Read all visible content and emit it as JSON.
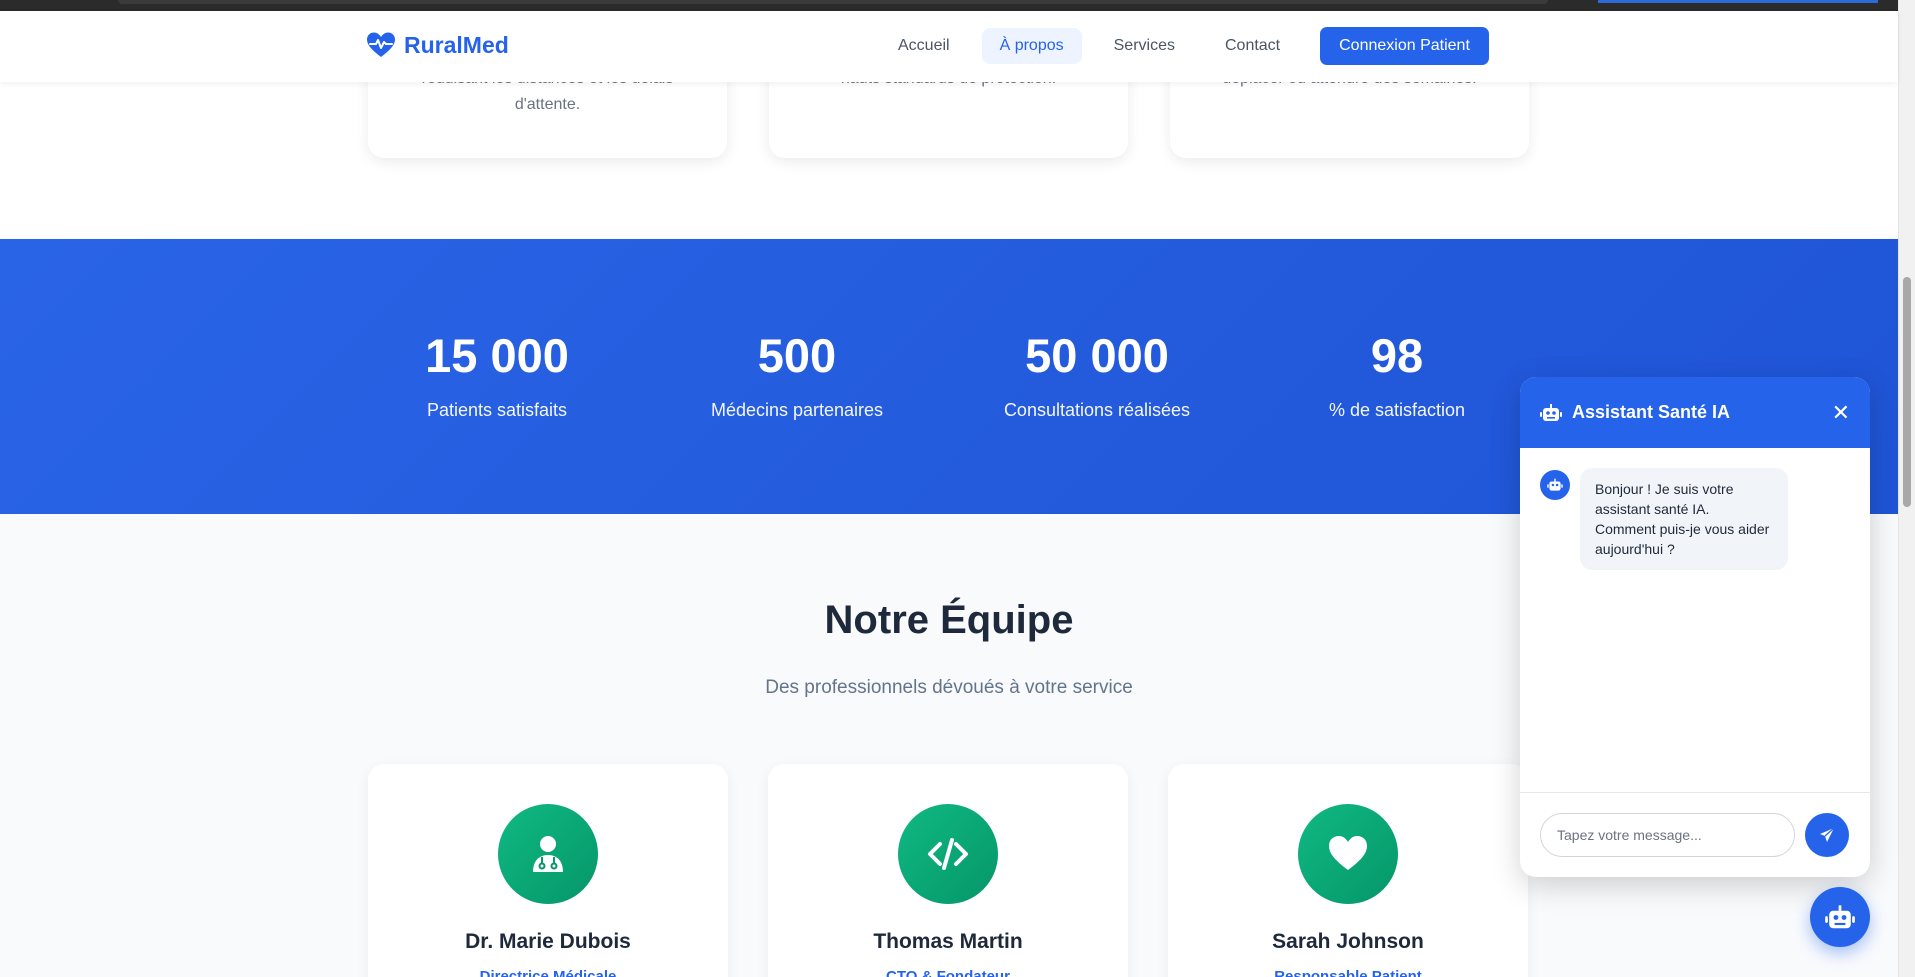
{
  "brand": {
    "name": "RuralMed",
    "color": "#2563eb"
  },
  "nav": {
    "items": [
      "Accueil",
      "À propos",
      "Services",
      "Contact"
    ],
    "active": "À propos",
    "login_label": "Connexion Patient"
  },
  "features": [
    {
      "text_line1": "réduisant les distances et les délais",
      "text_line2": "d'attente."
    },
    {
      "text_line1": "hauts standards de protection.",
      "text_line2": ""
    },
    {
      "text_line1": "déplacer ou attendre des semaines.",
      "text_line2": ""
    }
  ],
  "stats": [
    {
      "value": "15 000",
      "label": "Patients satisfaits"
    },
    {
      "value": "500",
      "label": "Médecins partenaires"
    },
    {
      "value": "50 000",
      "label": "Consultations réalisées"
    },
    {
      "value": "98",
      "label": "% de satisfaction"
    }
  ],
  "team": {
    "title": "Notre Équipe",
    "subtitle": "Des professionnels dévoués à votre service",
    "members": [
      {
        "name": "Dr. Marie Dubois",
        "role": "Directrice Médicale",
        "icon": "user-doctor-icon"
      },
      {
        "name": "Thomas Martin",
        "role": "CTO & Fondateur",
        "icon": "code-icon"
      },
      {
        "name": "Sarah Johnson",
        "role": "Responsable Patient",
        "icon": "heart-icon"
      }
    ]
  },
  "chat": {
    "title": "Assistant Santé IA",
    "bot_message": "Bonjour ! Je suis votre assistant santé IA. Comment puis-je vous aider aujourd'hui ?",
    "input_placeholder": "Tapez votre message...",
    "input_value": ""
  },
  "colors": {
    "primary": "#2563eb",
    "accent_green": "#10b981",
    "stats_bg": "#2563eb"
  }
}
